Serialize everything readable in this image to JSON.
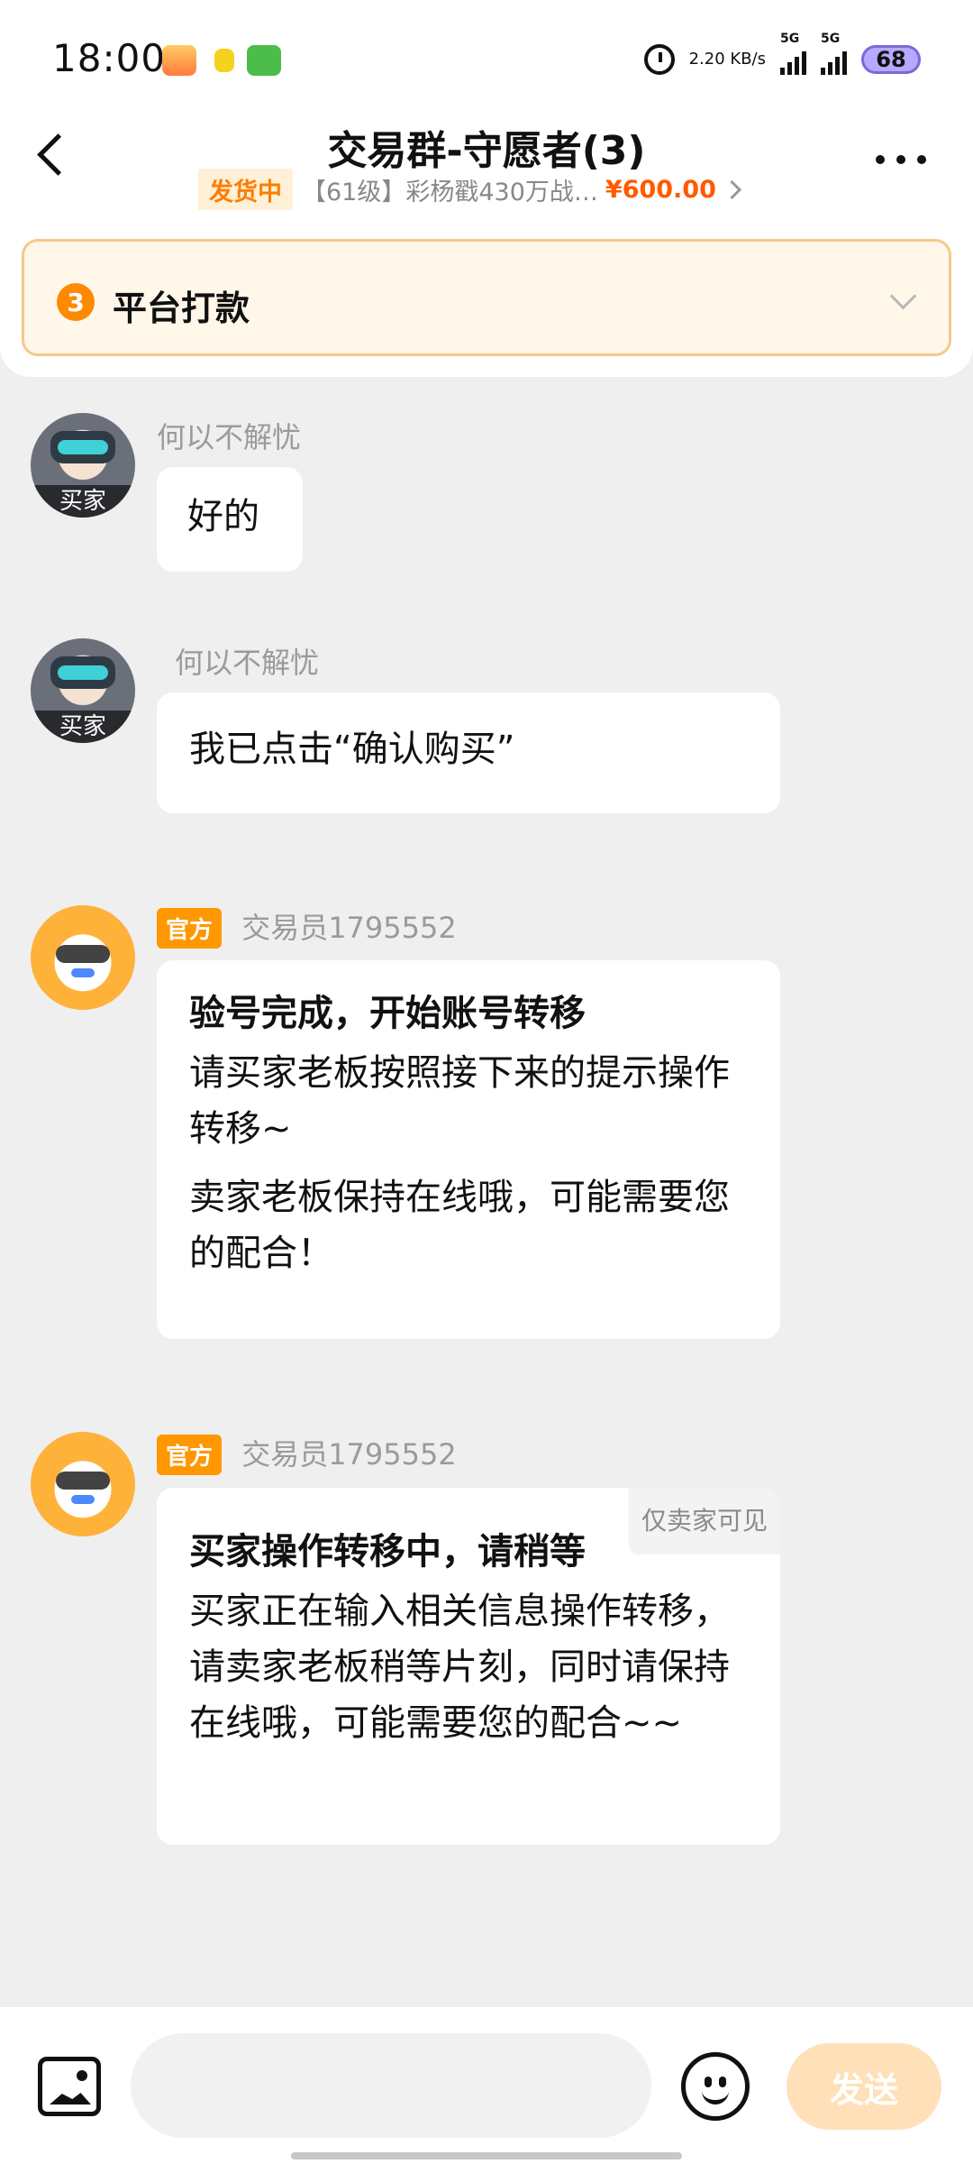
{
  "status_bar": {
    "time": "18:00",
    "net_speed": "2.20\nKB/s",
    "signal1": "5G",
    "signal2": "5G",
    "battery": "68"
  },
  "header": {
    "title": "交易群-守愿者(3)",
    "order_status": "发货中",
    "goods_title": "【61级】彩杨戳430万战…",
    "price": "¥600.00"
  },
  "stage": {
    "step": "3",
    "label": "平台打款"
  },
  "messages": [
    {
      "sender": "何以不解忧",
      "role_tag": "买家",
      "text": "好的"
    },
    {
      "sender": "何以不解忧",
      "role_tag": "买家",
      "text": "我已点击“确认购买”"
    },
    {
      "official_label": "官方",
      "sender": "交易员1795552",
      "title": "验号完成，开始账号转移",
      "p1": "请买家老板按照接下来的提示操作转移~",
      "p2": "卖家老板保持在线哦，可能需要您的配合！"
    },
    {
      "official_label": "官方",
      "sender": "交易员1795552",
      "visibility": "仅卖家可见",
      "title": "买家操作转移中，请稍等",
      "p1": "买家正在输入相关信息操作转移，请卖家老板稍等片刻，同时请保持在线哦，可能需要您的配合~~"
    }
  ],
  "input_bar": {
    "placeholder": "",
    "send_label": "发送"
  }
}
